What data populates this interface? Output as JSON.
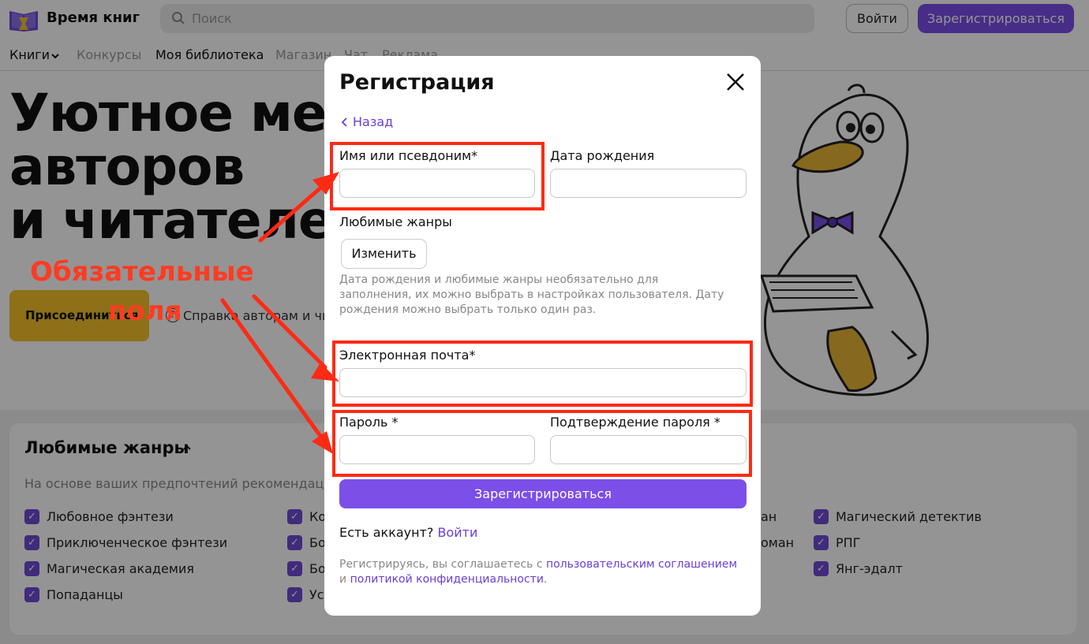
{
  "header": {
    "logo_text": "Время книг",
    "search_placeholder": "Поиск",
    "login_label": "Войти",
    "register_label": "Зарегистрироваться"
  },
  "nav": {
    "items": [
      "Книги",
      "Конкурсы",
      "Моя библиотека",
      "Магазин",
      "Чат",
      "Реклама"
    ]
  },
  "hero": {
    "title_lines": [
      "Уютное мест",
      "авторов",
      "и читателей"
    ],
    "join_label": "Присоединиться",
    "help_label": "Справка авторам и чи"
  },
  "genres": {
    "title": "Любимые жанры",
    "subtitle": "На основе ваших предпочтений рекомендации",
    "col1": [
      "Любовное фэнтези",
      "Приключенческое фэнтези",
      "Магическая академия",
      "Попаданцы"
    ],
    "col2": [
      "Ко",
      "Бо",
      "Бо",
      "Ус"
    ],
    "col3": [
      "ан",
      "оман"
    ],
    "col4": [
      "Магический детектив",
      "РПГ",
      "Янг-эдалт"
    ]
  },
  "modal": {
    "title": "Регистрация",
    "back_label": "Назад",
    "name_label": "Имя или псевдоним*",
    "birth_label": "Дата рождения",
    "genres_label": "Любимые жанры",
    "change_label": "Изменить",
    "hint": "Дата рождения и любимые жанры необязательно для заполнения, их можно выбрать в настройках пользователя. Дату рождения можно выбрать только один раз.",
    "email_label": "Электронная почта*",
    "password_label": "Пароль *",
    "password_confirm_label": "Подтверждение пароля *",
    "submit_label": "Зарегистрироваться",
    "account_text": "Есть аккаунт?",
    "account_link": "Войти",
    "terms_prefix": "Регистрируясь, вы соглашаетесь с",
    "terms_link1": "пользовательским соглашением",
    "terms_and": "и",
    "terms_link2": "политикой конфиденциальности",
    "terms_suffix": "."
  },
  "annotation": {
    "line1": "Обязательные",
    "line2": "поля"
  },
  "colors": {
    "accent": "#7b4fe8",
    "link": "#6a3ed9",
    "annotation": "#ff2a14",
    "join_button": "#f3c12a"
  }
}
